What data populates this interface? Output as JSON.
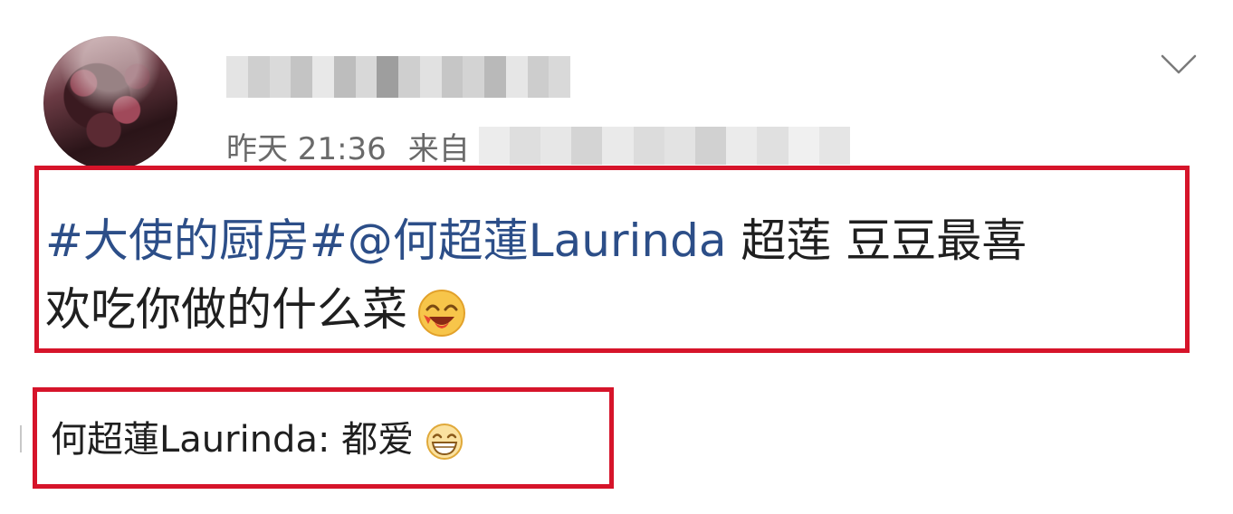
{
  "header": {
    "time_label": "昨天 21:36",
    "source_prefix": "来自"
  },
  "post": {
    "topic": "#大使的厨房#",
    "mention": "@何超蓮Laurinda",
    "text_line1": " 超莲 豆豆最喜",
    "text_line2": "欢吃你做的什么菜",
    "emoji_name": "heart-eyes-smile-emoji"
  },
  "reply": {
    "author": "何超蓮Laurinda",
    "separator": ": ",
    "text": "都爱",
    "emoji_name": "grin-emoji"
  },
  "colors": {
    "highlight_border": "#d6142a",
    "link": "#2c4e88",
    "meta_text": "#6a6a6a",
    "body_text": "#1f1f1f"
  },
  "icons": {
    "expand": "chevron-down-icon"
  }
}
